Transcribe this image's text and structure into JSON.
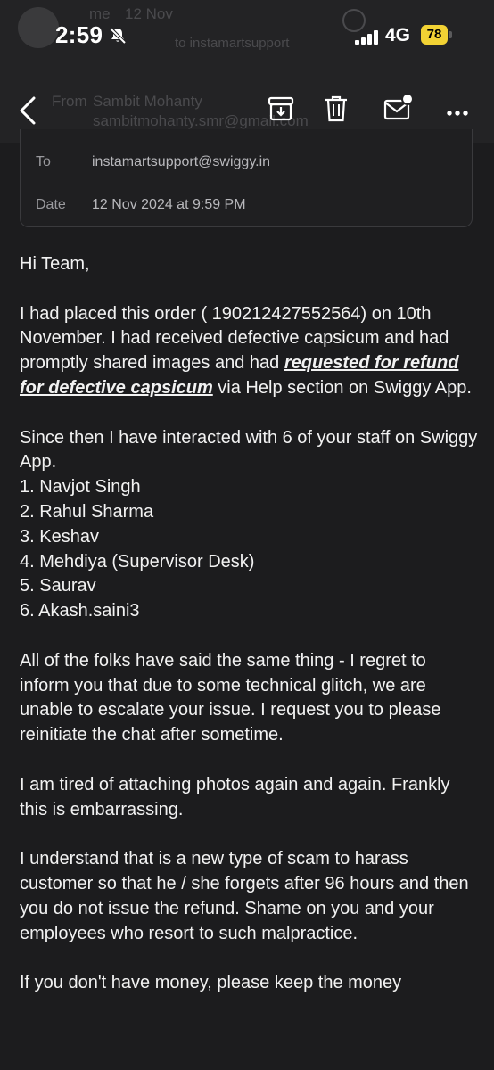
{
  "status_bar": {
    "time": "2:59",
    "network": "4G",
    "battery": "78"
  },
  "background_ghost": {
    "sender_short": "me",
    "sender_date": "12 Nov",
    "from_label": "From",
    "from_name": "Sambit Mohanty",
    "from_email": "sambitmohanty.smr@gmail.com",
    "recipient_snippet": "to instamartsupport"
  },
  "toolbar": {
    "back_icon": "chevron-left-icon",
    "archive_icon": "archive-icon",
    "delete_icon": "trash-icon",
    "mark_unread_icon": "mail-unread-icon",
    "more_icon": "more-icon"
  },
  "header": {
    "to_label": "To",
    "to_value": "instamartsupport@swiggy.in",
    "date_label": "Date",
    "date_value": "12 Nov 2024 at 9:59 PM"
  },
  "body": {
    "greeting": "Hi Team,",
    "p1_start": "I had placed this order ( 190212427552564) on 10th November. I had received defective capsicum and had promptly shared images and had ",
    "p1_emphasis": "requested for refund for defective capsicum",
    "p1_end": " via Help section on Swiggy App.",
    "p2_intro": "Since then I have interacted with 6 of your staff on Swiggy App.",
    "staff": [
      "1. Navjot Singh",
      "2. Rahul Sharma",
      "3. Keshav",
      "4. Mehdiya (Supervisor Desk)",
      "5. Saurav",
      "6. Akash.saini3"
    ],
    "p3": "All of the folks have said the same thing - I regret to inform you that due to some technical glitch, we are unable to escalate your issue. I request you to please reinitiate the chat after sometime.",
    "p4": "I am tired of attaching photos again and again. Frankly this is embarrassing.",
    "p5": "I understand that is a new type of scam to harass customer so that he / she forgets after 96 hours and then you do not issue the refund. Shame on you and your employees who resort to such malpractice.",
    "p6_partial": "If you don't have money, please keep the money"
  },
  "colors": {
    "background": "#1c1c1e",
    "battery": "#f2d234",
    "accent": "#ffffff"
  }
}
